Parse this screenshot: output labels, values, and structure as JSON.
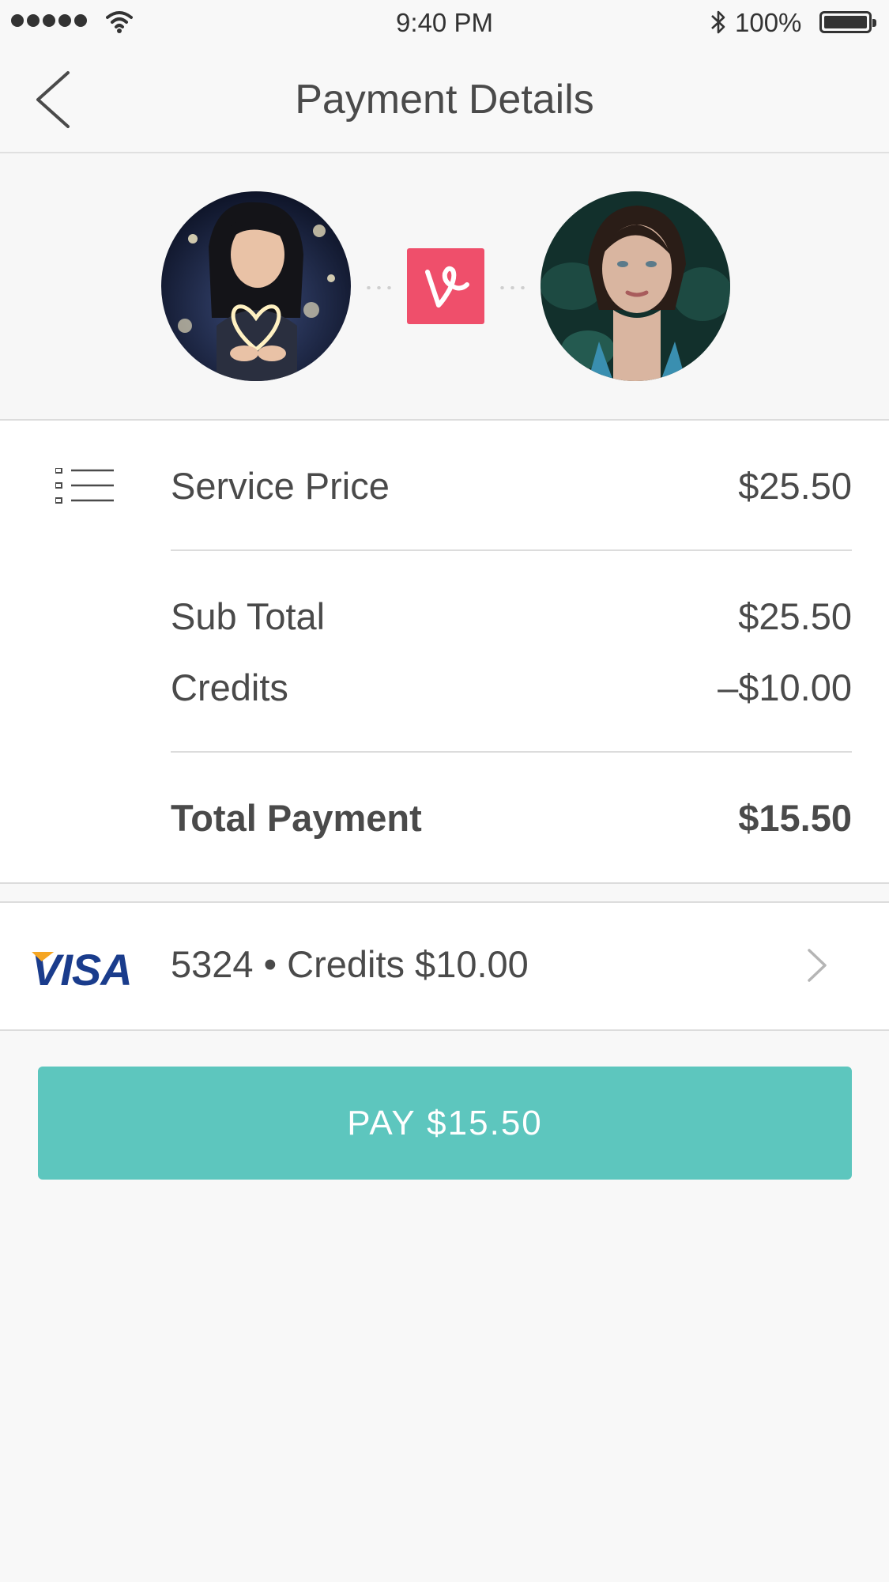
{
  "status_bar": {
    "time": "9:40 PM",
    "battery": "100%"
  },
  "nav": {
    "title": "Payment Details"
  },
  "summary": {
    "service_price_label": "Service Price",
    "service_price_value": "$25.50",
    "subtotal_label": "Sub Total",
    "subtotal_value": "$25.50",
    "credits_label": "Credits",
    "credits_value": "–$10.00",
    "total_label": "Total Payment",
    "total_value": "$15.50"
  },
  "payment_method": {
    "brand": "VISA",
    "detail": "5324 • Credits $10.00"
  },
  "pay_button": {
    "label": "PAY $15.50"
  },
  "colors": {
    "accent": "#5dc6be",
    "logo": "#ef4f6b",
    "visa_blue": "#1a3c8c"
  },
  "icons": [
    "wifi-icon",
    "bluetooth-icon",
    "battery-icon",
    "back-chevron-icon",
    "vine-logo",
    "list-icon",
    "visa-logo",
    "chevron-right-icon"
  ]
}
